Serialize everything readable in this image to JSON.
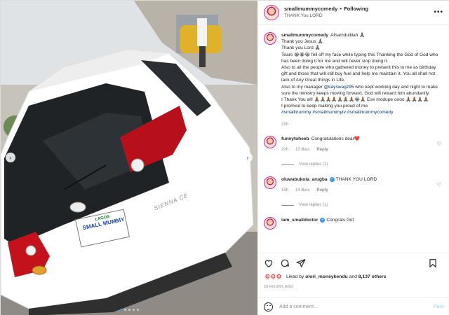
{
  "post": {
    "username": "smallmummycomedy",
    "follow_label": "Following",
    "location": "THANK You LORD"
  },
  "caption": {
    "paragraphs": [
      "Alhamdullilah 🙏🏾",
      "Thank you Jesus 🙏🏾",
      "Thank you Lord 🙏🏾",
      "Tears 😭😭😭 fell off my face while typing this Thanking the God of God who has been doing it for me and will never stop doing it.",
      "",
      "Also to all the people who gathered money to present this to me as birthday gift and those that will still buy fuel and help me maintain it. You all shall not lack of Any Great things in Life.",
      "Also to my manager"
    ],
    "mention": "@kayswagz95",
    "after_mention": " who kept working day and night to make sure the ministry keeps moving forward. God will reward him abundantly.",
    "closing": "I Thank You all! 🙏🏾🙏🏾🙏🏾🙏🏾🙏🏾🙏🏾🙏🏾😭🙏🏾 Ese modupe oooo 🙏🏾🙏🏾🙏🏾🙏🏾",
    "promise": "I promise to keep making you proud of me",
    "hashtags": "#smallmummy #smallmummytv #smallmummycomedy",
    "time": "20h"
  },
  "comments": [
    {
      "username": "funnytoheeb",
      "text": "Congratulations dear❤️",
      "age": "20h",
      "likes": "13 likes",
      "reply": "Reply",
      "view_replies": "View replies (1)",
      "verified": false
    },
    {
      "username": "oluwabukola_arugba",
      "text": "THANK YOU LORD",
      "age": "15h",
      "likes": "14 likes",
      "reply": "Reply",
      "view_replies": "View replies (1)",
      "verified": true
    },
    {
      "username": "iam_smalldoctor",
      "text": "Congrats Girl",
      "verified": true
    }
  ],
  "likes": {
    "prefix": "Liked by",
    "first_user": "olori_moneykendu",
    "joiner": "and",
    "others": "8,137 others"
  },
  "posted": "20 HOURS AGO",
  "add_comment": {
    "placeholder": "Add a comment...",
    "post_label": "Post"
  },
  "colors": {
    "link": "#00376b",
    "muted": "#8e8e8e",
    "accent": "#3897f0",
    "like_red": "#ed4956"
  },
  "plate": {
    "state": "LAGOS",
    "text": "SMALL MUMMY"
  },
  "car": {
    "brand_badge": "SIENNA CE"
  }
}
